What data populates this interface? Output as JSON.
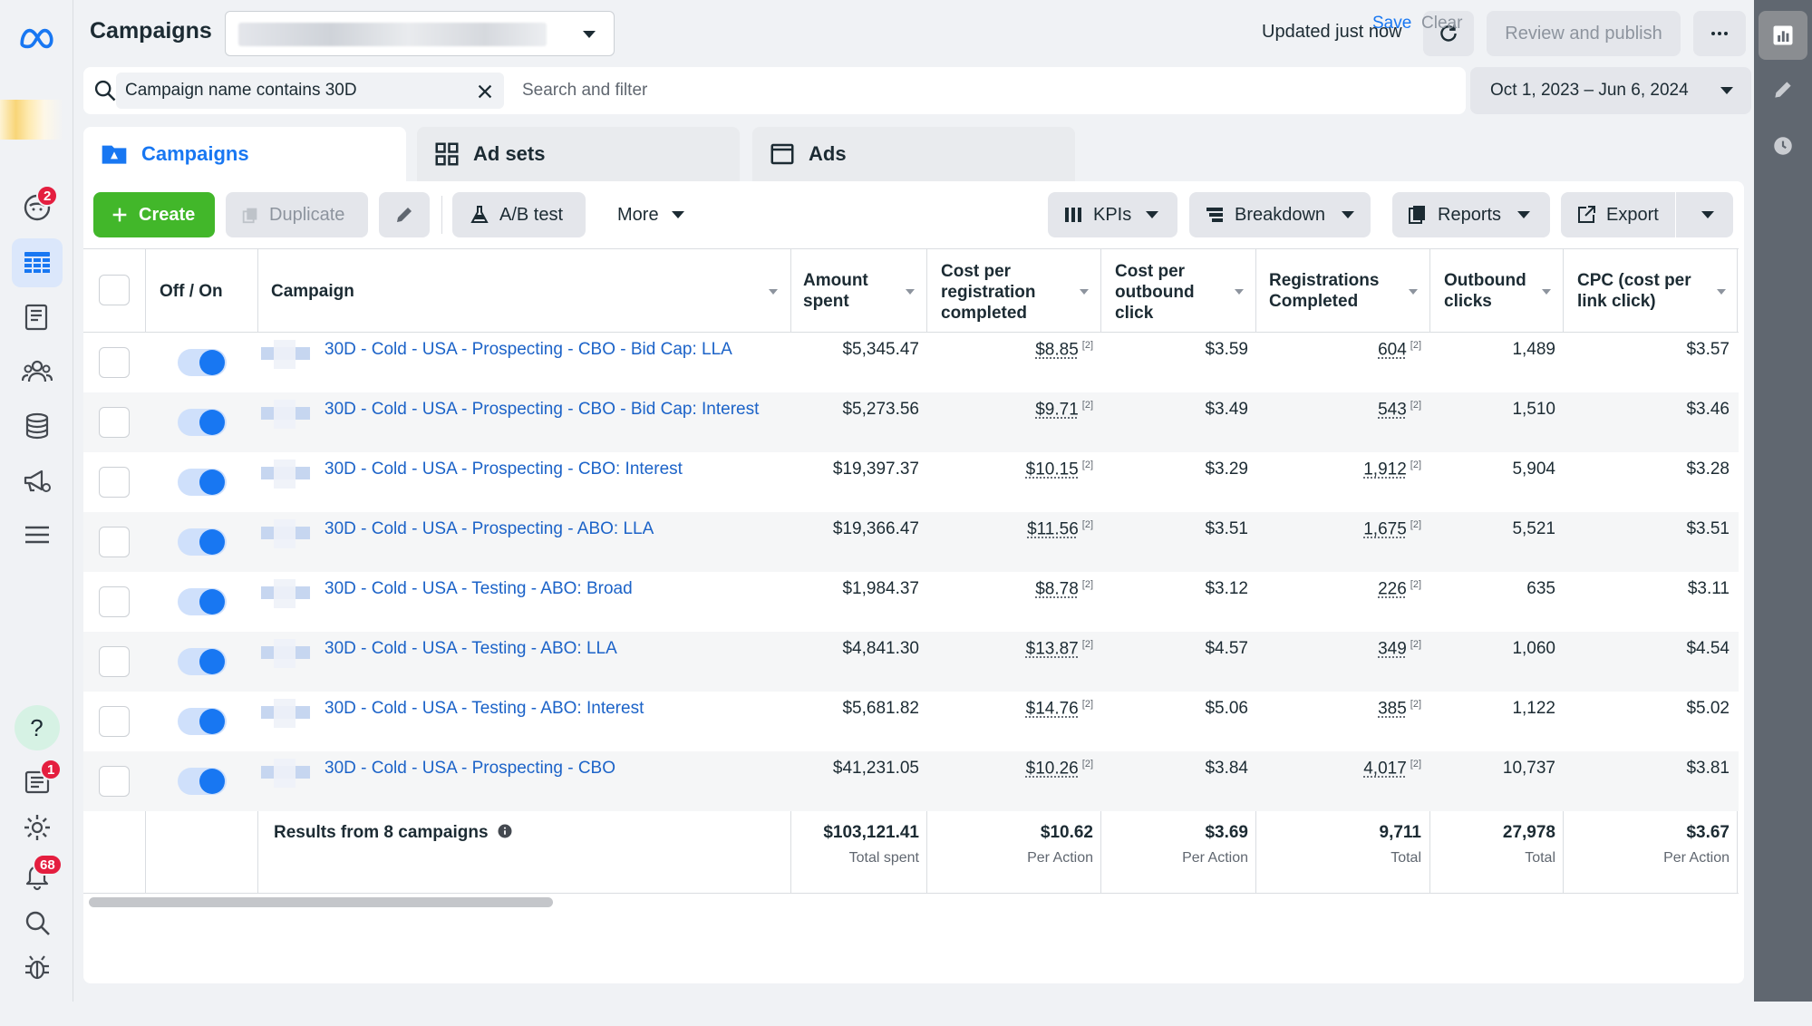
{
  "header": {
    "title": "Campaigns",
    "updated": "Updated just now",
    "review_publish": "Review and publish"
  },
  "nav": {
    "notification_badge": "2",
    "bottom_badge_1": "1",
    "bottom_badge_68": "68"
  },
  "search": {
    "chip_label": "Campaign name contains 30D",
    "placeholder": "Search and filter",
    "save": "Save",
    "clear": "Clear",
    "date_range": "Oct 1, 2023 – Jun 6, 2024"
  },
  "tabs": [
    {
      "label": "Campaigns"
    },
    {
      "label": "Ad sets"
    },
    {
      "label": "Ads"
    }
  ],
  "toolbar": {
    "create": "Create",
    "duplicate": "Duplicate",
    "ab_test": "A/B test",
    "more": "More",
    "kpis": "KPIs",
    "breakdown": "Breakdown",
    "reports": "Reports",
    "export": "Export"
  },
  "table": {
    "columns": {
      "off_on": "Off / On",
      "campaign": "Campaign",
      "amount_spent": "Amount spent",
      "cost_per_reg": "Cost per registration completed",
      "cost_per_click": "Cost per outbound click",
      "registrations": "Registrations Completed",
      "outbound_clicks": "Outbound clicks",
      "cpc": "CPC (cost per link click)"
    },
    "note_mark": "[2]",
    "rows": [
      {
        "name": "30D - Cold - USA - Prospecting - CBO - Bid Cap: LLA",
        "spent": "$5,345.47",
        "cpr": "$8.85",
        "cpoc": "$3.59",
        "reg": "604",
        "clicks": "1,489",
        "cpc": "$3.57"
      },
      {
        "name": "30D - Cold - USA - Prospecting - CBO - Bid Cap: Interest",
        "spent": "$5,273.56",
        "cpr": "$9.71",
        "cpoc": "$3.49",
        "reg": "543",
        "clicks": "1,510",
        "cpc": "$3.46"
      },
      {
        "name": "30D - Cold - USA - Prospecting - CBO: Interest",
        "spent": "$19,397.37",
        "cpr": "$10.15",
        "cpoc": "$3.29",
        "reg": "1,912",
        "clicks": "5,904",
        "cpc": "$3.28"
      },
      {
        "name": "30D - Cold - USA - Prospecting - ABO: LLA",
        "spent": "$19,366.47",
        "cpr": "$11.56",
        "cpoc": "$3.51",
        "reg": "1,675",
        "clicks": "5,521",
        "cpc": "$3.51"
      },
      {
        "name": "30D - Cold - USA - Testing - ABO: Broad",
        "spent": "$1,984.37",
        "cpr": "$8.78",
        "cpoc": "$3.12",
        "reg": "226",
        "clicks": "635",
        "cpc": "$3.11"
      },
      {
        "name": "30D - Cold - USA - Testing - ABO: LLA",
        "spent": "$4,841.30",
        "cpr": "$13.87",
        "cpoc": "$4.57",
        "reg": "349",
        "clicks": "1,060",
        "cpc": "$4.54"
      },
      {
        "name": "30D - Cold - USA - Testing - ABO: Interest",
        "spent": "$5,681.82",
        "cpr": "$14.76",
        "cpoc": "$5.06",
        "reg": "385",
        "clicks": "1,122",
        "cpc": "$5.02"
      },
      {
        "name": "30D - Cold - USA - Prospecting - CBO",
        "spent": "$41,231.05",
        "cpr": "$10.26",
        "cpoc": "$3.84",
        "reg": "4,017",
        "clicks": "10,737",
        "cpc": "$3.81"
      }
    ],
    "totals": {
      "label": "Results from 8 campaigns",
      "spent": "$103,121.41",
      "spent_sub": "Total spent",
      "cpr": "$10.62",
      "cpr_sub": "Per Action",
      "cpoc": "$3.69",
      "cpoc_sub": "Per Action",
      "reg": "9,711",
      "reg_sub": "Total",
      "clicks": "27,978",
      "clicks_sub": "Total",
      "cpc": "$3.67",
      "cpc_sub": "Per Action"
    }
  },
  "colors": {
    "accent": "#1877f2",
    "create_green": "#42b72a",
    "link": "#1c63c8",
    "badge_red": "#e41e3f"
  }
}
